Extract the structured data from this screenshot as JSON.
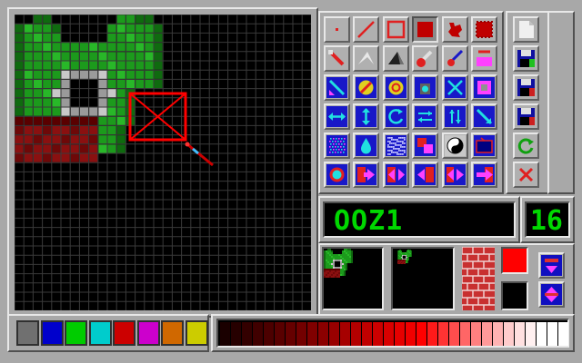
{
  "sprite": {
    "name": "OOZ1",
    "number": "16"
  },
  "tools": {
    "row1": [
      "pixel-tool-icon",
      "line-tool-icon",
      "rect-outline-tool-icon",
      "filled-rect-tool-icon",
      "blob-brush-tool-icon",
      "filled-blob-tool-icon"
    ],
    "row2": [
      "pencil-tool-icon",
      "eraser-tool-icon",
      "dark-wedge-tool-icon",
      "fill-brush-tool-icon",
      "spray-brush-tool-icon",
      "replace-color-tool-icon"
    ],
    "row3": [
      "flip-diagonal-icon",
      "rotate-badge-icon",
      "swap-badge-icon",
      "bucket-fill-icon",
      "scissors-icon",
      "grab-block-icon"
    ],
    "row4": [
      "flip-horizontal-icon",
      "flip-vertical-icon",
      "rotate-icon",
      "shift-left-right-icon",
      "shift-up-down-icon",
      "flip-diagonal-tool-icon"
    ],
    "row5": [
      "dither-icon",
      "drip-icon",
      "noise-icon",
      "color-cycle-icon",
      "yin-yang-icon",
      "tv-screen-icon"
    ],
    "row6": [
      "magnify-icon",
      "insert-right-icon",
      "insert-left-right-icon",
      "merge-left-icon",
      "merge-both-icon",
      "merge-right-icon"
    ]
  },
  "side_buttons": [
    "new-page-icon",
    "save-disk-1-icon",
    "save-disk-2-icon",
    "save-disk-3-icon",
    "reload-icon",
    "close-icon"
  ],
  "palette": {
    "colors": [
      "#707070",
      "#0000cc",
      "#00cc00",
      "#00cccc",
      "#cc0000",
      "#cc00cc",
      "#d06800",
      "#cccc00"
    ],
    "shades": [
      "#1a0000",
      "#260000",
      "#330000",
      "#400000",
      "#4c0000",
      "#590000",
      "#660000",
      "#730000",
      "#800000",
      "#8c0000",
      "#990000",
      "#a60000",
      "#b30000",
      "#c00000",
      "#cc0000",
      "#d90000",
      "#e60000",
      "#f00000",
      "#ff0000",
      "#ff1a1a",
      "#ff3333",
      "#ff4d4d",
      "#ff6666",
      "#ff8080",
      "#ff9999",
      "#ffb3b3",
      "#ffcccc",
      "#ffe0e0",
      "#fff0f0",
      "#ffffff",
      "#ffffff",
      "#ffffff"
    ],
    "foreground": "#ff0000",
    "background": "#000000"
  },
  "colors": {
    "accent": "#00d800",
    "grid": "#3a3a3a",
    "selection": "#ff0000"
  }
}
